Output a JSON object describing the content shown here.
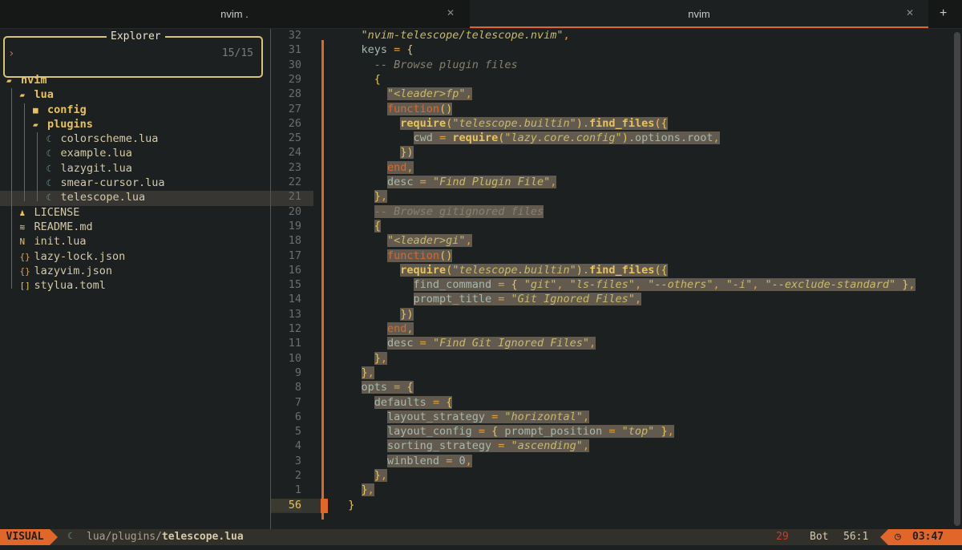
{
  "tabs": [
    {
      "label": "nvim .",
      "close": "✕"
    },
    {
      "label": "nvim",
      "close": "✕"
    }
  ],
  "tab_plus": "+",
  "explorer": {
    "title": "Explorer",
    "prompt": "›",
    "count": "15/15",
    "items": [
      {
        "depth": 0,
        "icon": "folder-open-icon",
        "glyph": "▰",
        "label": "nvim",
        "color": "#e8c35a",
        "bold": true
      },
      {
        "depth": 1,
        "icon": "folder-open-icon",
        "glyph": "▰",
        "label": "lua",
        "color": "#e8c35a",
        "bold": true
      },
      {
        "depth": 2,
        "icon": "folder-icon",
        "glyph": "■",
        "label": "config",
        "color": "#e8c35a",
        "bold": true
      },
      {
        "depth": 2,
        "icon": "folder-open-icon",
        "glyph": "▰",
        "label": "plugins",
        "color": "#e8c35a",
        "bold": true
      },
      {
        "depth": 3,
        "icon": "lua-file-icon",
        "glyph": "☾",
        "label": "colorscheme.lua",
        "color": "#d4c9a8"
      },
      {
        "depth": 3,
        "icon": "lua-file-icon",
        "glyph": "☾",
        "label": "example.lua",
        "color": "#d4c9a8"
      },
      {
        "depth": 3,
        "icon": "lua-file-icon",
        "glyph": "☾",
        "label": "lazygit.lua",
        "color": "#d4c9a8"
      },
      {
        "depth": 3,
        "icon": "lua-file-icon",
        "glyph": "☾",
        "label": "smear-cursor.lua",
        "color": "#d4c9a8"
      },
      {
        "depth": 3,
        "icon": "lua-file-icon",
        "glyph": "☾",
        "label": "telescope.lua",
        "color": "#d4c9a8",
        "selected": true
      },
      {
        "depth": 1,
        "icon": "license-icon",
        "glyph": "♟",
        "label": "LICENSE",
        "color": "#d4c9a8"
      },
      {
        "depth": 1,
        "icon": "markdown-icon",
        "glyph": "≋",
        "label": "README.md",
        "color": "#d4c9a8"
      },
      {
        "depth": 1,
        "icon": "neovim-icon",
        "glyph": "N",
        "label": "init.lua",
        "color": "#d4c9a8"
      },
      {
        "depth": 1,
        "icon": "json-icon",
        "glyph": "{}",
        "label": "lazy-lock.json",
        "color": "#d4c9a8"
      },
      {
        "depth": 1,
        "icon": "json-icon",
        "glyph": "{}",
        "label": "lazyvim.json",
        "color": "#d4c9a8"
      },
      {
        "depth": 1,
        "icon": "toml-icon",
        "glyph": "[]",
        "label": "stylua.toml",
        "color": "#d4c9a8"
      }
    ]
  },
  "editor": {
    "lines": [
      {
        "n": "32",
        "sel": false,
        "tokens": [
          [
            "",
            "    "
          ],
          [
            "str",
            "\"nvim-telescope/telescope.nvim\""
          ],
          [
            "op",
            ","
          ]
        ]
      },
      {
        "n": "31",
        "sel": false,
        "tokens": [
          [
            "",
            "    "
          ],
          [
            "id",
            "keys"
          ],
          [
            "op",
            " = "
          ],
          [
            "pn",
            "{"
          ]
        ]
      },
      {
        "n": "30",
        "sel": false,
        "tokens": [
          [
            "",
            "      "
          ],
          [
            "cm",
            "-- Browse plugin files"
          ]
        ]
      },
      {
        "n": "29",
        "sel": false,
        "tokens": [
          [
            "",
            "      "
          ],
          [
            "pn",
            "{"
          ]
        ]
      },
      {
        "n": "28",
        "sel": true,
        "tokens": [
          [
            "",
            "        "
          ],
          [
            "str",
            "\"<leader>fp\""
          ],
          [
            "op",
            ","
          ]
        ]
      },
      {
        "n": "27",
        "sel": true,
        "tokens": [
          [
            "",
            "        "
          ],
          [
            "kw",
            "function"
          ],
          [
            "pn",
            "()"
          ]
        ]
      },
      {
        "n": "26",
        "sel": true,
        "tokens": [
          [
            "",
            "          "
          ],
          [
            "fn",
            "require"
          ],
          [
            "pn",
            "("
          ],
          [
            "str",
            "\"telescope.builtin\""
          ],
          [
            "pn",
            ")"
          ],
          [
            "id",
            "."
          ],
          [
            "fn",
            "find_files"
          ],
          [
            "pn",
            "({"
          ]
        ]
      },
      {
        "n": "25",
        "sel": true,
        "tokens": [
          [
            "",
            "            "
          ],
          [
            "id",
            "cwd"
          ],
          [
            "op",
            " = "
          ],
          [
            "fn",
            "require"
          ],
          [
            "pn",
            "("
          ],
          [
            "str",
            "\"lazy.core.config\""
          ],
          [
            "pn",
            ")"
          ],
          [
            "id",
            ".options.root"
          ],
          [
            "op",
            ","
          ]
        ]
      },
      {
        "n": "24",
        "sel": true,
        "tokens": [
          [
            "",
            "          "
          ],
          [
            "pn",
            "})"
          ]
        ]
      },
      {
        "n": "23",
        "sel": true,
        "tokens": [
          [
            "",
            "        "
          ],
          [
            "kw",
            "end"
          ],
          [
            "op",
            ","
          ]
        ]
      },
      {
        "n": "22",
        "sel": true,
        "tokens": [
          [
            "",
            "        "
          ],
          [
            "id",
            "desc"
          ],
          [
            "op",
            " = "
          ],
          [
            "str",
            "\"Find Plugin File\""
          ],
          [
            "op",
            ","
          ]
        ]
      },
      {
        "n": "21",
        "sel": true,
        "tokens": [
          [
            "",
            "      "
          ],
          [
            "pn",
            "}"
          ],
          [
            "op",
            ","
          ]
        ]
      },
      {
        "n": "20",
        "sel": true,
        "tokens": [
          [
            "",
            "      "
          ],
          [
            "cm",
            "-- Browse gitignored files"
          ]
        ]
      },
      {
        "n": "19",
        "sel": true,
        "tokens": [
          [
            "",
            "      "
          ],
          [
            "pn",
            "{"
          ]
        ]
      },
      {
        "n": "18",
        "sel": true,
        "tokens": [
          [
            "",
            "        "
          ],
          [
            "str",
            "\"<leader>gi\""
          ],
          [
            "op",
            ","
          ]
        ]
      },
      {
        "n": "17",
        "sel": true,
        "tokens": [
          [
            "",
            "        "
          ],
          [
            "kw",
            "function"
          ],
          [
            "pn",
            "()"
          ]
        ]
      },
      {
        "n": "16",
        "sel": true,
        "tokens": [
          [
            "",
            "          "
          ],
          [
            "fn",
            "require"
          ],
          [
            "pn",
            "("
          ],
          [
            "str",
            "\"telescope.builtin\""
          ],
          [
            "pn",
            ")"
          ],
          [
            "id",
            "."
          ],
          [
            "fn",
            "find_files"
          ],
          [
            "pn",
            "({"
          ]
        ]
      },
      {
        "n": "15",
        "sel": true,
        "tokens": [
          [
            "",
            "            "
          ],
          [
            "id",
            "find_command"
          ],
          [
            "op",
            " = "
          ],
          [
            "pn",
            "{ "
          ],
          [
            "str",
            "\"git\""
          ],
          [
            "op",
            ", "
          ],
          [
            "str",
            "\"ls-files\""
          ],
          [
            "op",
            ", "
          ],
          [
            "str",
            "\"--others\""
          ],
          [
            "op",
            ", "
          ],
          [
            "str",
            "\"-i\""
          ],
          [
            "op",
            ", "
          ],
          [
            "str",
            "\"--exclude-standard\""
          ],
          [
            "pn",
            " }"
          ],
          [
            "op",
            ","
          ]
        ]
      },
      {
        "n": "14",
        "sel": true,
        "tokens": [
          [
            "",
            "            "
          ],
          [
            "id",
            "prompt_title"
          ],
          [
            "op",
            " = "
          ],
          [
            "str",
            "\"Git Ignored Files\""
          ],
          [
            "op",
            ","
          ]
        ]
      },
      {
        "n": "13",
        "sel": true,
        "tokens": [
          [
            "",
            "          "
          ],
          [
            "pn",
            "})"
          ]
        ]
      },
      {
        "n": "12",
        "sel": true,
        "tokens": [
          [
            "",
            "        "
          ],
          [
            "kw",
            "end"
          ],
          [
            "op",
            ","
          ]
        ]
      },
      {
        "n": "11",
        "sel": true,
        "tokens": [
          [
            "",
            "        "
          ],
          [
            "id",
            "desc"
          ],
          [
            "op",
            " = "
          ],
          [
            "str",
            "\"Find Git Ignored Files\""
          ],
          [
            "op",
            ","
          ]
        ]
      },
      {
        "n": "10",
        "sel": true,
        "tokens": [
          [
            "",
            "      "
          ],
          [
            "pn",
            "}"
          ],
          [
            "op",
            ","
          ]
        ]
      },
      {
        "n": "9",
        "sel": true,
        "tokens": [
          [
            "",
            "    "
          ],
          [
            "pn",
            "}"
          ],
          [
            "op",
            ","
          ]
        ]
      },
      {
        "n": "8",
        "sel": true,
        "tokens": [
          [
            "",
            "    "
          ],
          [
            "id",
            "opts"
          ],
          [
            "op",
            " = "
          ],
          [
            "pn",
            "{"
          ]
        ]
      },
      {
        "n": "7",
        "sel": true,
        "tokens": [
          [
            "",
            "      "
          ],
          [
            "id",
            "defaults"
          ],
          [
            "op",
            " = "
          ],
          [
            "pn",
            "{"
          ]
        ]
      },
      {
        "n": "6",
        "sel": true,
        "tokens": [
          [
            "",
            "        "
          ],
          [
            "id",
            "layout_strategy"
          ],
          [
            "op",
            " = "
          ],
          [
            "str",
            "\"horizontal\""
          ],
          [
            "op",
            ","
          ]
        ]
      },
      {
        "n": "5",
        "sel": true,
        "tokens": [
          [
            "",
            "        "
          ],
          [
            "id",
            "layout_config"
          ],
          [
            "op",
            " = "
          ],
          [
            "pn",
            "{ "
          ],
          [
            "id",
            "prompt_position"
          ],
          [
            "op",
            " = "
          ],
          [
            "str",
            "\"top\""
          ],
          [
            "pn",
            " }"
          ],
          [
            "op",
            ","
          ]
        ]
      },
      {
        "n": "4",
        "sel": true,
        "tokens": [
          [
            "",
            "        "
          ],
          [
            "id",
            "sorting_strategy"
          ],
          [
            "op",
            " = "
          ],
          [
            "str",
            "\"ascending\""
          ],
          [
            "op",
            ","
          ]
        ]
      },
      {
        "n": "3",
        "sel": true,
        "tokens": [
          [
            "",
            "        "
          ],
          [
            "id",
            "winblend"
          ],
          [
            "op",
            " = "
          ],
          [
            "id",
            "0"
          ],
          [
            "op",
            ","
          ]
        ]
      },
      {
        "n": "2",
        "sel": true,
        "tokens": [
          [
            "",
            "      "
          ],
          [
            "pn",
            "}"
          ],
          [
            "op",
            ","
          ]
        ]
      },
      {
        "n": "1",
        "sel": true,
        "tokens": [
          [
            "",
            "    "
          ],
          [
            "pn",
            "}"
          ],
          [
            "op",
            ","
          ]
        ]
      },
      {
        "n": "56",
        "sel": false,
        "current": true,
        "tokens": [
          [
            "",
            "  "
          ],
          [
            "pn",
            "}"
          ]
        ]
      }
    ]
  },
  "status": {
    "mode": "VISUAL",
    "file_dir": "lua/plugins/",
    "file_name": "telescope.lua",
    "errors": "29",
    "position_label": "Bot",
    "cursor": "56:1",
    "clock_icon": "◷",
    "time": "03:47"
  },
  "colors": {
    "accent": "#e0662a",
    "selection": "#625a4e",
    "background": "#1d2021"
  }
}
